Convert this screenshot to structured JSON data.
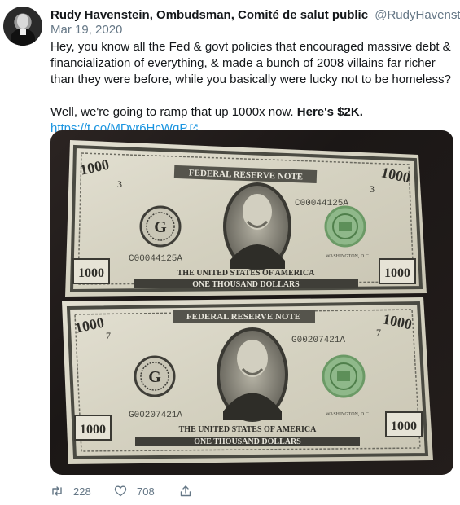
{
  "tweet": {
    "display_name": "Rudy Havenstein, Ombudsman, Comité de salut public",
    "handle": "@RudyHavenstein",
    "more_indicator": "·",
    "date": "Mar 19, 2020",
    "text": {
      "para1": "Hey, you know all the Fed & govt policies that encouraged massive debt & financialization of everything, & made a bunch of 2008 villains far richer than they were before, while you basically were lucky not to be homeless?",
      "para2_plain": "Well, we're going to ramp that up 1000x now.",
      "para2_bold": "Here's $2K.",
      "link": "https://t.co/MDyr6HcWqP"
    }
  },
  "media": {
    "bill_top": {
      "header": "FEDERAL RESERVE NOTE",
      "serial": "C00044125A",
      "letter": "G",
      "corner_value": "1000",
      "corner_mark": "3",
      "footer_top": "THE UNITED STATES OF AMERICA",
      "footer_bottom": "ONE THOUSAND DOLLARS",
      "place": "WASHINGTON, D.C."
    },
    "bill_bottom": {
      "header": "FEDERAL RESERVE NOTE",
      "serial": "G00207421A",
      "letter": "G",
      "corner_value": "1000",
      "corner_mark": "7",
      "footer_top": "THE UNITED STATES OF AMERICA",
      "footer_bottom": "ONE THOUSAND DOLLARS",
      "place": "WASHINGTON, D.C."
    }
  },
  "actions": {
    "retweet_count": "228",
    "like_count": "708"
  },
  "colors": {
    "link": "#1b95e0",
    "muted": "#657786",
    "bill_paper": "#d9d6c6",
    "bill_ink": "#3b3b35",
    "seal_green": "#7fae7a"
  }
}
